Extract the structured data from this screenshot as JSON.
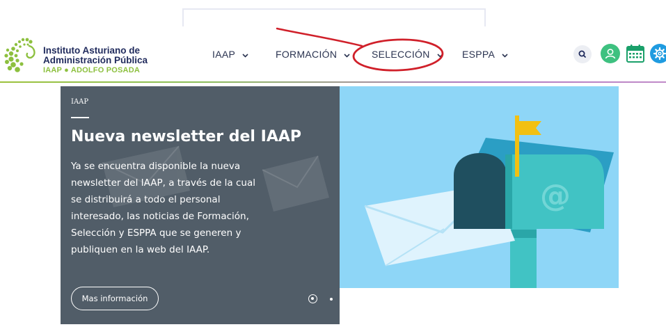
{
  "logo": {
    "line1": "Instituto Asturiano de",
    "line2": "Administración Pública",
    "line3": "IAAP ● ADOLFO POSADA"
  },
  "nav": [
    {
      "label": "IAAP"
    },
    {
      "label": "FORMACIÓN"
    },
    {
      "label": "SELECCIÓN"
    },
    {
      "label": "ESPPA"
    }
  ],
  "header_icons": [
    "search-icon",
    "user-icon",
    "calendar-icon",
    "gear-icon"
  ],
  "hero": {
    "tag": "IAAP",
    "title": "Nueva newsletter del IAAP",
    "body": "Ya se encuentra disponible la nueva newsletter del IAAP, a través de la cual se distribuirá a todo el personal interesado, las noticias de Formación, Selección y ESPPA que se generen y publiquen en la web del IAAP.",
    "button_label": "Mas información",
    "slides_count": 2,
    "active_slide": 1
  },
  "colors": {
    "brand_navy": "#1f2a5c",
    "brand_green": "#8dc03f",
    "hero_left_bg": "#515d68",
    "hero_right_bg": "#8ed6f7",
    "annotation_red": "#d0202a"
  }
}
